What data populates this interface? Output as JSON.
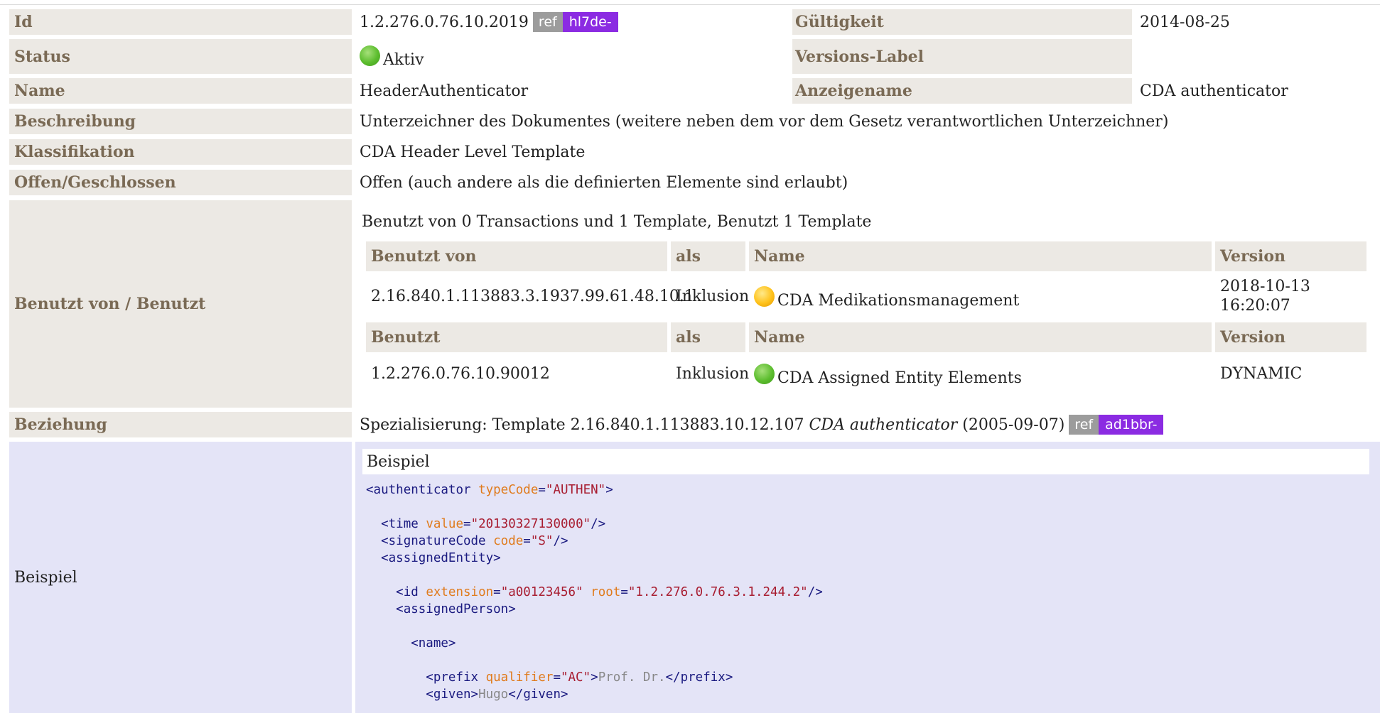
{
  "rows": {
    "id": {
      "label": "Id",
      "value": "1.2.276.0.76.10.2019",
      "ref": "ref",
      "ref_tag": "hl7de-"
    },
    "gueltigkeit": {
      "label": "Gültigkeit",
      "value": "2014-08-25"
    },
    "status": {
      "label": "Status",
      "value": "Aktiv",
      "status_color": "green"
    },
    "versions_label": {
      "label": "Versions-Label",
      "value": ""
    },
    "name": {
      "label": "Name",
      "value": "HeaderAuthenticator"
    },
    "anzeigename": {
      "label": "Anzeigename",
      "value": "CDA authenticator"
    },
    "beschreibung": {
      "label": "Beschreibung",
      "value": "Unterzeichner des Dokumentes (weitere neben dem vor dem Gesetz verantwortlichen Unterzeichner)"
    },
    "klassifikation": {
      "label": "Klassifikation",
      "value": "CDA Header Level Template"
    },
    "offen": {
      "label": "Offen/Geschlossen",
      "value": "Offen (auch andere als die definierten Elemente sind erlaubt)"
    },
    "benutzt": {
      "label": "Benutzt von / Benutzt"
    },
    "beziehung": {
      "label": "Beziehung"
    },
    "beispiel": {
      "label": "Beispiel"
    }
  },
  "usage": {
    "summary": "Benutzt von 0 Transactions und 1 Template, Benutzt 1 Template",
    "used_by_headers": [
      "Benutzt von",
      "als",
      "Name",
      "Version"
    ],
    "used_by": [
      {
        "id": "2.16.840.1.113883.3.1937.99.61.48.10.1",
        "als": "Inklusion",
        "status": "yellow",
        "name": "CDA Medikationsmanagement",
        "version_date": "2018-10-13",
        "version_time": "16:20:07"
      }
    ],
    "uses_headers": [
      "Benutzt",
      "als",
      "Name",
      "Version"
    ],
    "uses": [
      {
        "id": "1.2.276.0.76.10.90012",
        "als": "Inklusion",
        "status": "green",
        "name": "CDA Assigned Entity Elements",
        "version": "DYNAMIC"
      }
    ]
  },
  "relationship": {
    "prefix": "Spezialisierung: Template 2.16.840.1.113883.10.12.107",
    "name_italic": "CDA authenticator",
    "date": "(2005-09-07)",
    "ref": "ref",
    "ref_tag": "ad1bbr-"
  },
  "example": {
    "title": "Beispiel",
    "code": {
      "authenticator_tag": "authenticator",
      "typeCode_attr": "typeCode",
      "typeCode_val": "\"AUTHEN\"",
      "time_tag": "time",
      "time_attr": "value",
      "time_val": "\"20130327130000\"",
      "signatureCode_tag": "signatureCode",
      "signatureCode_attr": "code",
      "signatureCode_val": "\"S\"",
      "assignedEntity_tag": "assignedEntity",
      "id_tag": "id",
      "id_ext_attr": "extension",
      "id_ext_val": "\"a00123456\"",
      "id_root_attr": "root",
      "id_root_val": "\"1.2.276.0.76.3.1.244.2\"",
      "assignedPerson_tag": "assignedPerson",
      "name_tag": "name",
      "prefix_tag": "prefix",
      "prefix_attr": "qualifier",
      "prefix_val": "\"AC\"",
      "prefix_text": "Prof. Dr.",
      "given_tag": "given",
      "given_text": "Hugo"
    }
  },
  "colors": {
    "label_bg": "#ece9e4",
    "label_text": "#7a6a55",
    "ref_tag_bg": "#8b2be2",
    "ref_bg": "#9c9c9c",
    "example_bg": "#e4e4f7"
  }
}
